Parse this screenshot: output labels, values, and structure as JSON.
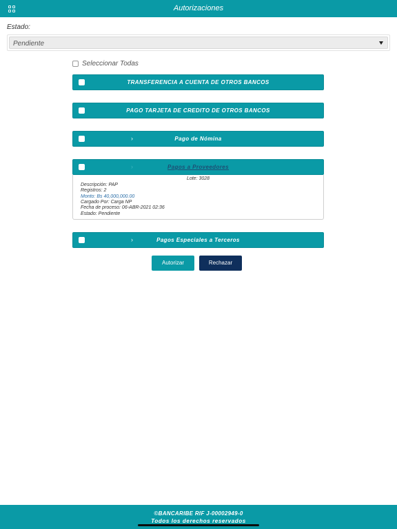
{
  "header": {
    "title": "Autorizaciones",
    "menu_icon": "grid-icon"
  },
  "filter": {
    "label": "Estado:",
    "selected": "Pendiente"
  },
  "select_all_label": "Seleccionar Todas",
  "groups": [
    {
      "name": "TRANSFERENCIA A CUENTA DE OTROS BANCOS"
    },
    {
      "name": "PAGO TARJETA DE CREDITO DE OTROS BANCOS"
    },
    {
      "name": "Pago de Nómina"
    },
    {
      "name": "Pagos a Proveedores",
      "detail": {
        "lote": "Lote: 3028",
        "descripcion": "Descripción: PAP",
        "registros": "Registros: 2",
        "monto": "Monto: Bs 40,000,000.00",
        "cargado_por": "Cargado Por: Carga NP",
        "fecha": "Fecha de proceso: 06-ABR-2021 02:36",
        "estado": "Estado: Pendiente"
      }
    },
    {
      "name": "Pagos Especiales a Terceros"
    }
  ],
  "actions": {
    "authorize": "Autorizar",
    "reject": "Rechazar"
  },
  "footer": {
    "line1": "©BANCARIBE RIF   J-00002949-0",
    "line2": "Todos los derechos reservados"
  },
  "colors": {
    "primary": "#0a9aa6",
    "dark": "#0f2f5c",
    "link": "#2c6fa8"
  }
}
